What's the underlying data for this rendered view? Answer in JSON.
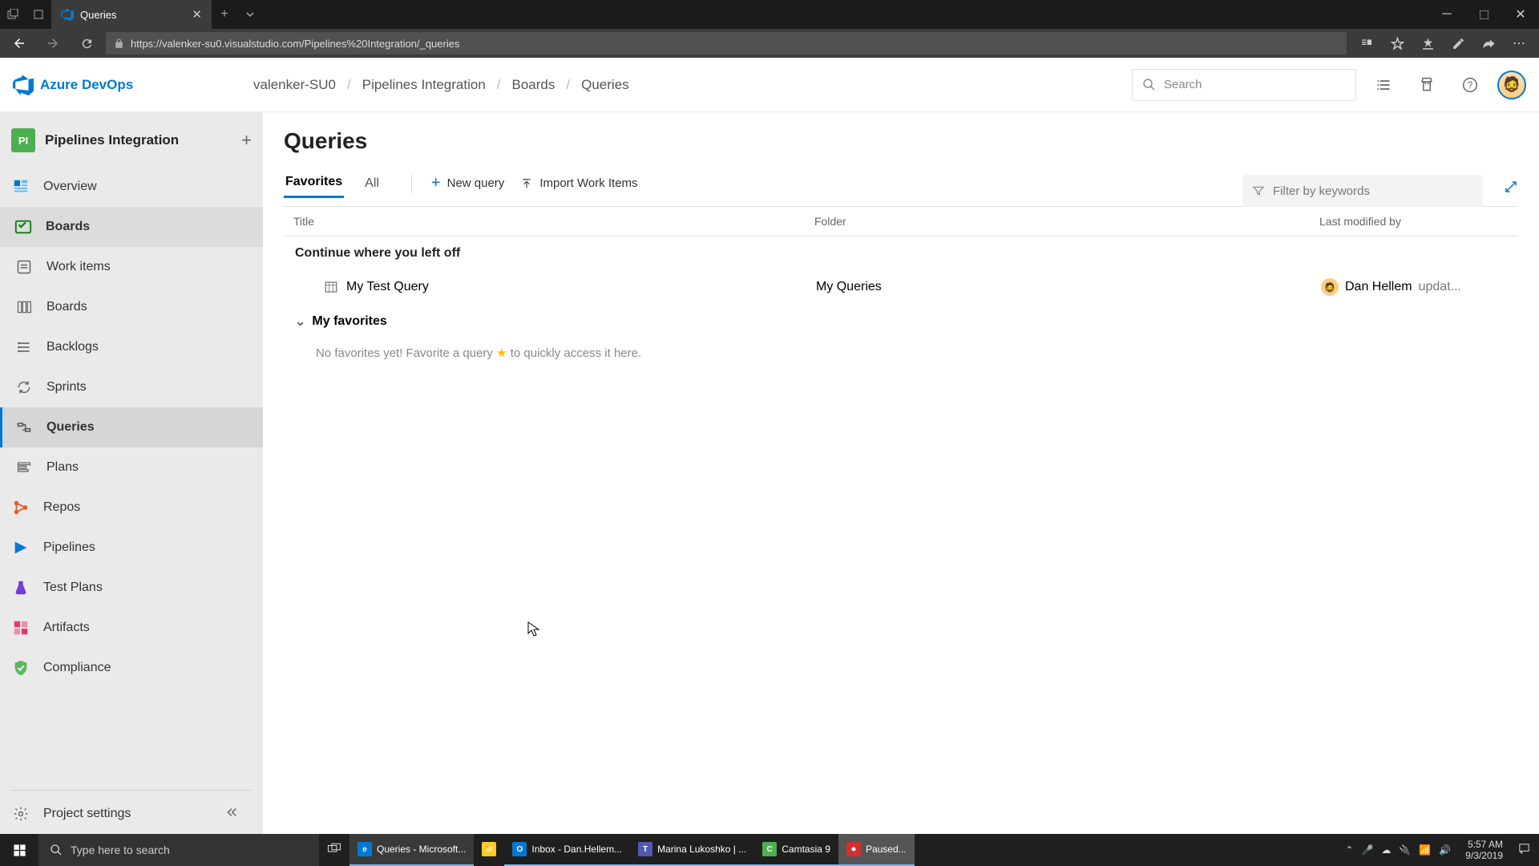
{
  "browser": {
    "tab_title": "Queries",
    "url": "https://valenker-su0.visualstudio.com/Pipelines%20Integration/_queries"
  },
  "header": {
    "product": "Azure DevOps",
    "breadcrumbs": [
      "valenker-SU0",
      "Pipelines Integration",
      "Boards",
      "Queries"
    ],
    "search_placeholder": "Search"
  },
  "sidebar": {
    "project_badge": "PI",
    "project_name": "Pipelines Integration",
    "items": [
      {
        "label": "Overview"
      },
      {
        "label": "Boards"
      },
      {
        "label": "Work items"
      },
      {
        "label": "Boards"
      },
      {
        "label": "Backlogs"
      },
      {
        "label": "Sprints"
      },
      {
        "label": "Queries"
      },
      {
        "label": "Plans"
      },
      {
        "label": "Repos"
      },
      {
        "label": "Pipelines"
      },
      {
        "label": "Test Plans"
      },
      {
        "label": "Artifacts"
      },
      {
        "label": "Compliance"
      }
    ],
    "settings": "Project settings"
  },
  "main": {
    "title": "Queries",
    "tabs": {
      "favorites": "Favorites",
      "all": "All"
    },
    "actions": {
      "new_query": "New query",
      "import": "Import Work Items"
    },
    "filter_placeholder": "Filter by keywords",
    "columns": {
      "title": "Title",
      "folder": "Folder",
      "modified": "Last modified by"
    },
    "continue_section": "Continue where you left off",
    "query": {
      "name": "My Test Query",
      "folder": "My Queries",
      "modified_by": "Dan Hellem",
      "modified_suffix": "updat..."
    },
    "favorites_section": "My favorites",
    "empty_prefix": "No favorites yet! Favorite a query ",
    "empty_suffix": " to quickly access it here."
  },
  "taskbar": {
    "search_placeholder": "Type here to search",
    "items": [
      {
        "label": "Queries - Microsoft..."
      },
      {
        "label": ""
      },
      {
        "label": "Inbox - Dan.Hellem..."
      },
      {
        "label": "Marina Lukoshko | ..."
      },
      {
        "label": "Camtasia 9"
      },
      {
        "label": "Paused..."
      }
    ],
    "time": "5:57 AM",
    "date": "9/3/2019"
  }
}
